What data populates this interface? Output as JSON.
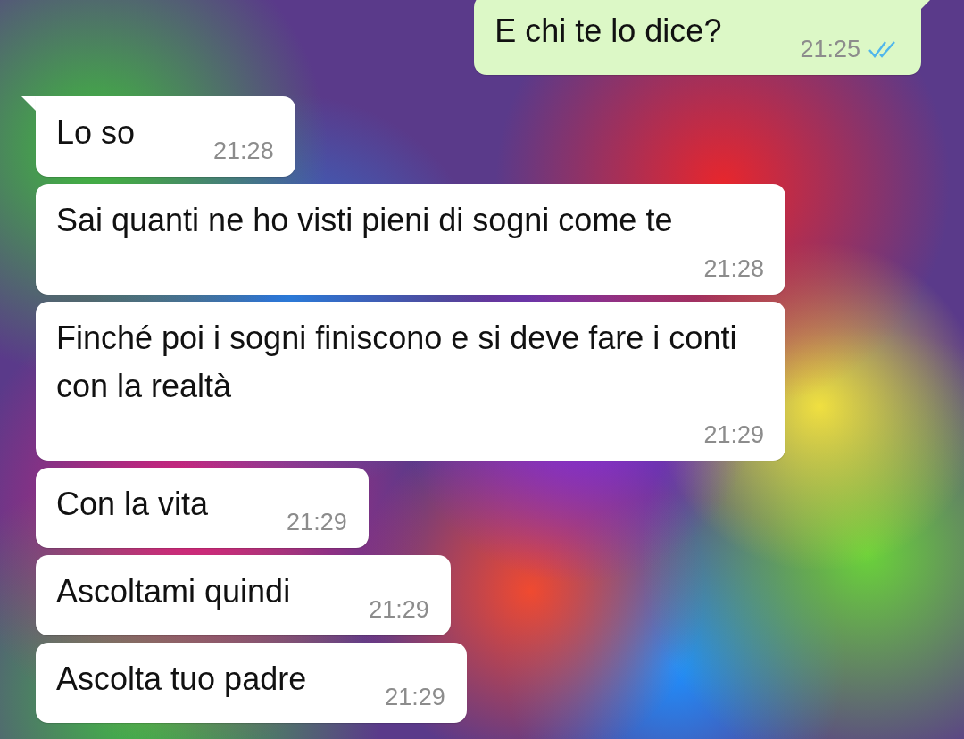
{
  "messages": [
    {
      "kind": "sent",
      "text": "E chi te lo dice?",
      "time": "21:25",
      "read": true,
      "tail": true
    },
    {
      "kind": "received",
      "text": "Lo so",
      "time": "21:28",
      "tail": true
    },
    {
      "kind": "received",
      "text": "Sai quanti ne ho visti pieni di sogni come te",
      "time": "21:28",
      "tail": false
    },
    {
      "kind": "received",
      "text": "Finché poi i sogni finiscono e si deve fare i conti con la realtà",
      "time": "21:29",
      "tail": false
    },
    {
      "kind": "received",
      "text": "Con la vita",
      "time": "21:29",
      "tail": false
    },
    {
      "kind": "received",
      "text": "Ascoltami quindi",
      "time": "21:29",
      "tail": false
    },
    {
      "kind": "received",
      "text": "Ascolta tuo padre",
      "time": "21:29",
      "tail": false
    }
  ]
}
